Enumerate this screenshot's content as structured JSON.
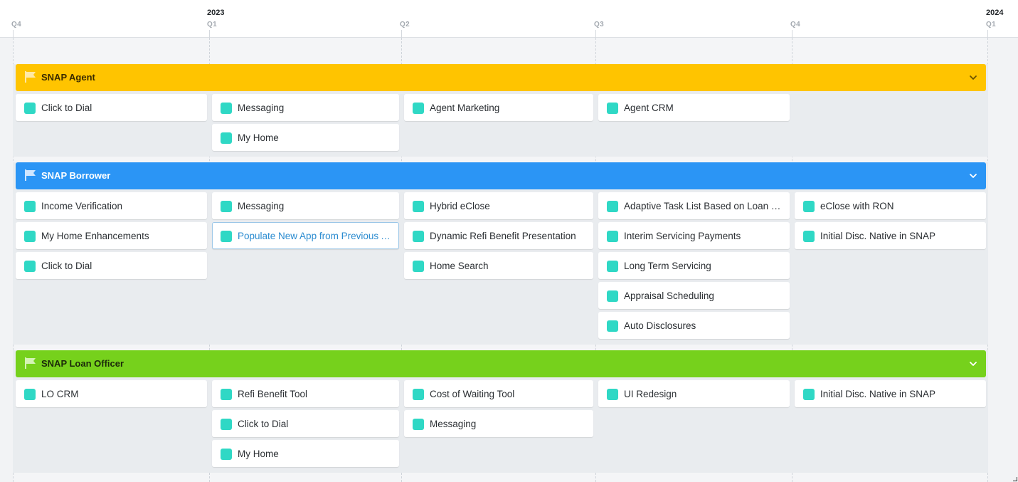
{
  "timeline": {
    "quarters": [
      "Q4",
      "Q1",
      "Q2",
      "Q3",
      "Q4",
      "Q1"
    ],
    "years": [
      "2023",
      "2024"
    ]
  },
  "colors": {
    "agent": "#ffc400",
    "borrower": "#2b95f5",
    "loan_officer": "#76d11c",
    "item_marker": "#2fd8c5"
  },
  "groups": [
    {
      "title": "SNAP Agent",
      "color": "#ffc400",
      "title_color": "#3a2a00",
      "columns": [
        [
          "Click to Dial"
        ],
        [
          "Messaging",
          "My Home"
        ],
        [
          "Agent Marketing"
        ],
        [
          "Agent CRM"
        ],
        []
      ]
    },
    {
      "title": "SNAP Borrower",
      "color": "#2b95f5",
      "title_color": "#ffffff",
      "columns": [
        [
          "Income Verification",
          "My Home Enhancements",
          "Click to Dial"
        ],
        [
          "Messaging",
          "Populate New App from Previous App"
        ],
        [
          "Hybrid eClose",
          "Dynamic Refi Benefit Presentation",
          "Home Search"
        ],
        [
          "Adaptive Task List Based on Loan Status",
          "Interim Servicing Payments",
          "Long Term Servicing",
          "Appraisal Scheduling",
          "Auto Disclosures"
        ],
        [
          "eClose with RON",
          "Initial Disc. Native in SNAP"
        ]
      ]
    },
    {
      "title": "SNAP Loan Officer",
      "color": "#76d11c",
      "title_color": "#1c2a0a",
      "columns": [
        [
          "LO CRM"
        ],
        [
          "Refi Benefit Tool",
          "Click to Dial",
          "My Home"
        ],
        [
          "Cost of Waiting Tool",
          "Messaging"
        ],
        [
          "UI Redesign"
        ],
        [
          "Initial Disc. Native in SNAP"
        ]
      ]
    }
  ]
}
